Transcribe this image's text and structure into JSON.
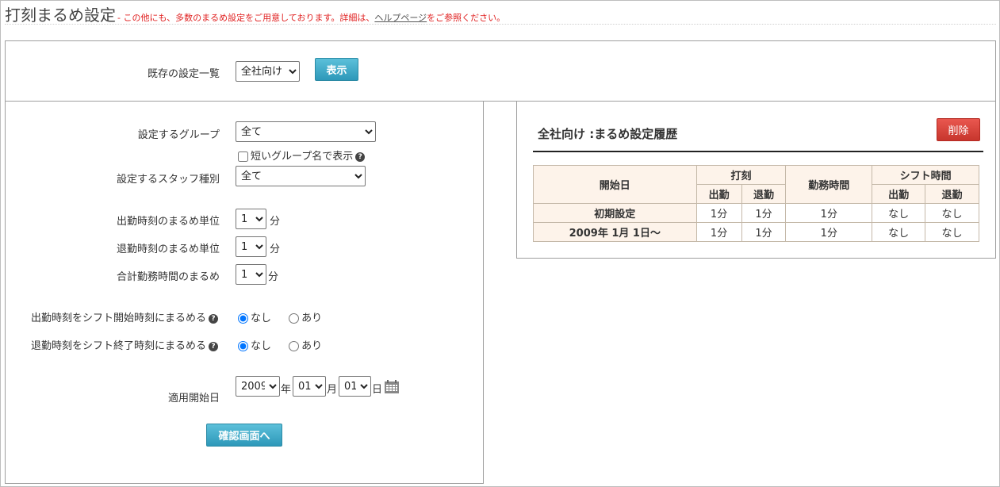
{
  "header": {
    "title": "打刻まるめ設定",
    "note_prefix": "- この他にも、多数のまるめ設定をご用意しております。詳細は、",
    "note_link": "ヘルプページ",
    "note_suffix": "をご参照ください。"
  },
  "top": {
    "existing_label": "既存の設定一覧",
    "existing_value": "全社向け",
    "show_button": "表示"
  },
  "form": {
    "group_label": "設定するグループ",
    "group_value": "全て",
    "short_group_label": "短いグループ名で表示",
    "staff_label": "設定するスタッフ種別",
    "staff_value": "全て",
    "in_unit_label": "出勤時刻のまるめ単位",
    "in_unit_value": "1",
    "out_unit_label": "退勤時刻のまるめ単位",
    "out_unit_value": "1",
    "total_label": "合計勤務時間のまるめ",
    "total_value": "1",
    "minute_unit": "分",
    "shift_start_label": "出勤時刻をシフト開始時刻にまるめる",
    "shift_end_label": "退勤時刻をシフト終了時刻にまるめる",
    "opt_none": "なし",
    "opt_yes": "あり",
    "apply_label": "適用開始日",
    "year_value": "2009",
    "year_unit": "年",
    "month_value": "01",
    "month_unit": "月",
    "day_value": "01",
    "day_unit": "日",
    "confirm_button": "確認画面へ"
  },
  "history": {
    "title": "全社向け :まるめ設定履歴",
    "delete_button": "削除",
    "col_start": "開始日",
    "col_stamp": "打刻",
    "col_in": "出勤",
    "col_out": "退勤",
    "col_work": "勤務時間",
    "col_shift": "シフト時間",
    "rows": [
      {
        "date": "初期設定",
        "in": "1分",
        "out": "1分",
        "work": "1分",
        "s_in": "なし",
        "s_out": "なし"
      },
      {
        "date": "2009年 1月 1日〜",
        "in": "1分",
        "out": "1分",
        "work": "1分",
        "s_in": "なし",
        "s_out": "なし"
      }
    ]
  }
}
